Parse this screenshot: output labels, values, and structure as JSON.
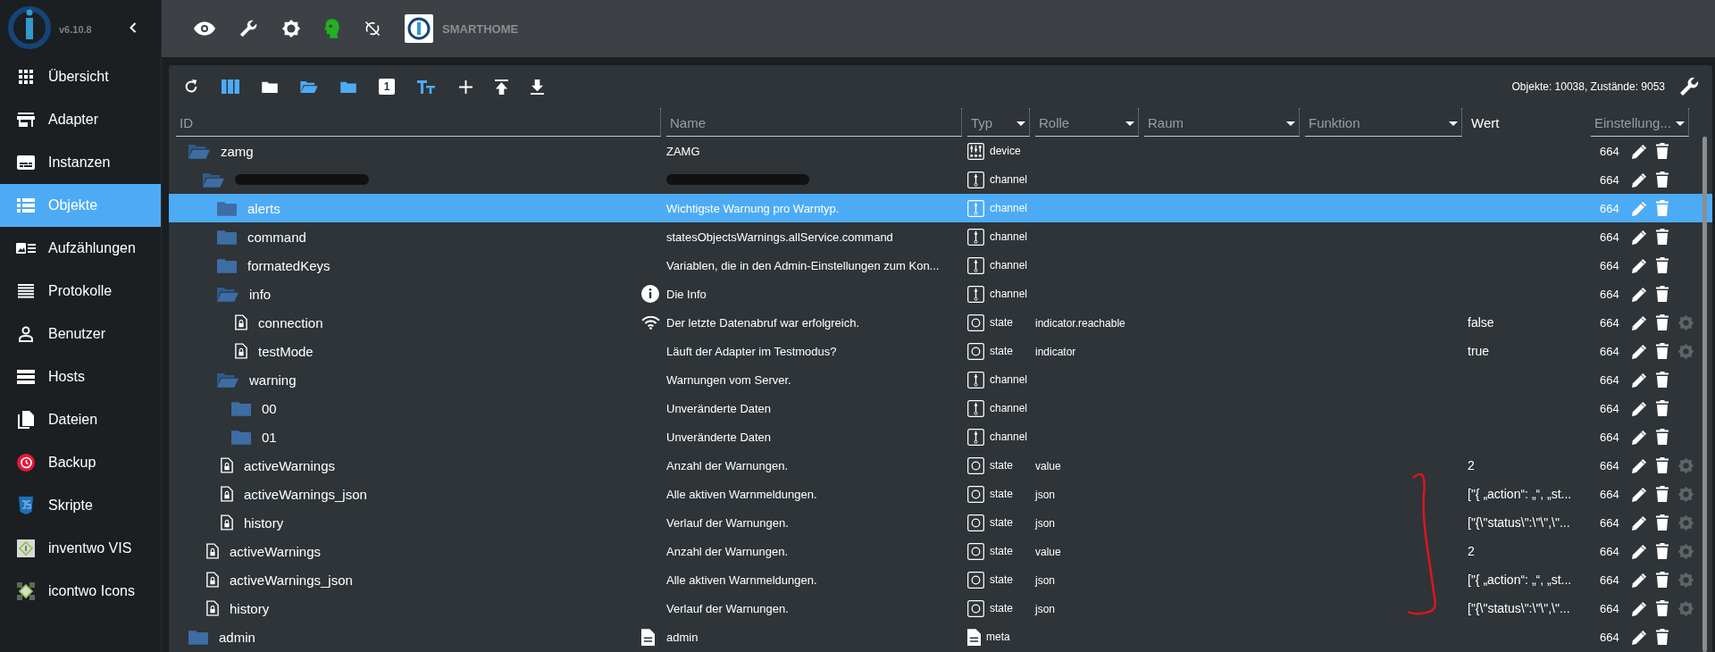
{
  "app": {
    "version": "v6.10.8",
    "title": "SMARTHOME"
  },
  "sidebar": {
    "items": [
      {
        "label": "Übersicht",
        "selected": false
      },
      {
        "label": "Adapter",
        "selected": false
      },
      {
        "label": "Instanzen",
        "selected": false
      },
      {
        "label": "Objekte",
        "selected": true
      },
      {
        "label": "Aufzählungen",
        "selected": false
      },
      {
        "label": "Protokolle",
        "selected": false
      },
      {
        "label": "Benutzer",
        "selected": false
      },
      {
        "label": "Hosts",
        "selected": false
      },
      {
        "label": "Dateien",
        "selected": false
      },
      {
        "label": "Backup",
        "selected": false
      },
      {
        "label": "Skripte",
        "selected": false
      },
      {
        "label": "inventwo VIS",
        "selected": false
      },
      {
        "label": "icontwo Icons",
        "selected": false
      }
    ]
  },
  "toolbar": {
    "depth_badge": "1",
    "stats": "Objekte: 10038, Zustände: 9053"
  },
  "table": {
    "columns": [
      {
        "label": "ID",
        "dropdown": false,
        "underline": true
      },
      {
        "label": "Name",
        "dropdown": false,
        "underline": true
      },
      {
        "label": "Typ",
        "dropdown": true,
        "underline": true
      },
      {
        "label": "Rolle",
        "dropdown": true,
        "underline": true
      },
      {
        "label": "Raum",
        "dropdown": true,
        "underline": true
      },
      {
        "label": "Funktion",
        "dropdown": true,
        "underline": true
      },
      {
        "label": "Wert",
        "dropdown": false,
        "underline": false
      },
      {
        "label": "Einstellung...",
        "dropdown": true,
        "underline": true
      }
    ],
    "tree": [
      {
        "id": "zamg",
        "name": "ZAMG",
        "expanded": true,
        "type": "device",
        "kind": "device",
        "acl": "664",
        "selected": false,
        "configurable": false,
        "children": [
          {
            "redacted": true,
            "expanded": true,
            "type": "channel",
            "kind": "channel",
            "acl": "664",
            "selected": false,
            "configurable": false,
            "children": [
              {
                "id": "alerts",
                "name": "Wichtigste Warnung pro Warntyp.",
                "expanded": false,
                "type": "channel",
                "kind": "channel",
                "acl": "664",
                "selected": true,
                "configurable": false
              },
              {
                "id": "command",
                "name": "statesObjectsWarnings.allService.command",
                "expanded": false,
                "type": "channel",
                "kind": "channel",
                "acl": "664",
                "selected": false,
                "configurable": false
              },
              {
                "id": "formatedKeys",
                "name": "Variablen, die in den Admin-Einstellungen zum Kon...",
                "expanded": false,
                "type": "channel",
                "kind": "channel",
                "acl": "664",
                "selected": false,
                "configurable": false
              },
              {
                "id": "info",
                "name": "Die Info",
                "name_badge": {
                  "kind": "info"
                },
                "expanded": true,
                "type": "channel",
                "kind": "channel",
                "acl": "664",
                "selected": false,
                "configurable": false,
                "children": [
                  {
                    "id": "connection",
                    "name": "Der letzte Datenabruf war erfolgreich.",
                    "name_badge": {
                      "kind": "wifi"
                    },
                    "type": "state",
                    "kind": "state",
                    "role": "indicator.reachable",
                    "value": "false",
                    "acl": "664",
                    "selected": false,
                    "configurable": true
                  },
                  {
                    "id": "testMode",
                    "name": "Läuft der Adapter im Testmodus?",
                    "type": "state",
                    "kind": "state",
                    "role": "indicator",
                    "value": "true",
                    "acl": "664",
                    "selected": false,
                    "configurable": true
                  }
                ]
              },
              {
                "id": "warning",
                "name": "Warnungen vom Server.",
                "expanded": true,
                "type": "channel",
                "kind": "channel",
                "acl": "664",
                "selected": false,
                "configurable": false,
                "children": [
                  {
                    "id": "00",
                    "name": "Unveränderte Daten",
                    "expanded": false,
                    "type": "channel",
                    "kind": "channel",
                    "acl": "664",
                    "selected": false,
                    "configurable": false
                  },
                  {
                    "id": "01",
                    "name": "Unveränderte Daten",
                    "expanded": false,
                    "type": "channel",
                    "kind": "channel",
                    "acl": "664",
                    "selected": false,
                    "configurable": false
                  }
                ]
              },
              {
                "id": "activeWarnings",
                "name": "Anzahl der Warnungen.",
                "type": "state",
                "kind": "state",
                "role": "value",
                "value": "2",
                "acl": "664",
                "selected": false,
                "configurable": true
              },
              {
                "id": "activeWarnings_json",
                "name": "Alle aktiven Warnmeldungen.",
                "type": "state",
                "kind": "state",
                "role": "json",
                "value": "[\"{ „action“: „“, „st...",
                "acl": "664",
                "selected": false,
                "configurable": true
              },
              {
                "id": "history",
                "name": "Verlauf der Warnungen.",
                "type": "state",
                "kind": "state",
                "role": "json",
                "value": "[\"{\\\"status\\\":\\\"\\\",\\\"...",
                "acl": "664",
                "selected": false,
                "configurable": true
              }
            ]
          },
          {
            "id": "activeWarnings",
            "name": "Anzahl der Warnungen.",
            "type": "state",
            "kind": "state",
            "role": "value",
            "value": "2",
            "acl": "664",
            "selected": false,
            "configurable": true
          },
          {
            "id": "activeWarnings_json",
            "name": "Alle aktiven Warnmeldungen.",
            "type": "state",
            "kind": "state",
            "role": "json",
            "value": "[\"{ „action“: „“, „st...",
            "acl": "664",
            "selected": false,
            "configurable": true
          },
          {
            "id": "history",
            "name": "Verlauf der Warnungen.",
            "type": "state",
            "kind": "state",
            "role": "json",
            "value": "[\"{\\\"status\\\":\\\"\\\",\\\"...",
            "acl": "664",
            "selected": false,
            "configurable": true
          }
        ]
      },
      {
        "id": "admin",
        "name": "admin",
        "name_badge": {
          "kind": "document"
        },
        "expanded": false,
        "type": "meta",
        "kind": "meta",
        "acl": "664",
        "selected": false,
        "configurable": false
      }
    ]
  }
}
